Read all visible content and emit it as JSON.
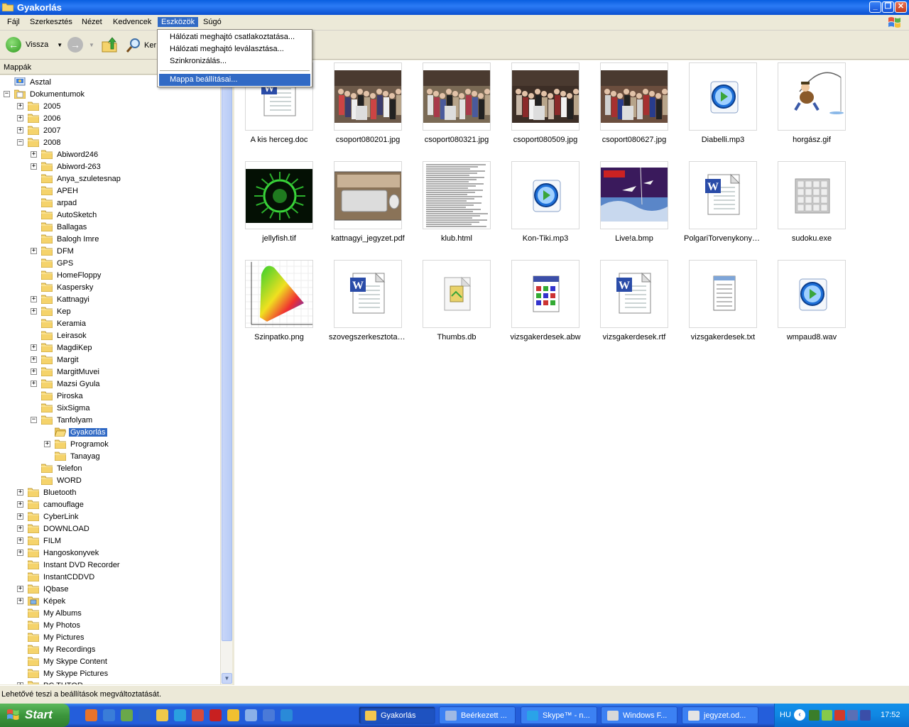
{
  "window": {
    "title": "Gyakorlás"
  },
  "menubar": {
    "items": [
      "Fájl",
      "Szerkesztés",
      "Nézet",
      "Kedvencek",
      "Eszközök",
      "Súgó"
    ],
    "active": "Eszközök"
  },
  "toolbar": {
    "back_label": "Vissza",
    "search_label": "Ker"
  },
  "dropdown": {
    "items": [
      "Hálózati meghajtó csatlakoztatása...",
      "Hálózati meghajtó leválasztása...",
      "Szinkronizálás...",
      "Mappa beállításai..."
    ],
    "highlighted": "Mappa beállításai..."
  },
  "folders_pane": {
    "title": "Mappák"
  },
  "tree": [
    {
      "label": "Asztal",
      "level": 0,
      "exp": "none",
      "icon": "desktop"
    },
    {
      "label": "Dokumentumok",
      "level": 0,
      "exp": "minus",
      "icon": "docs"
    },
    {
      "label": "2005",
      "level": 1,
      "exp": "plus"
    },
    {
      "label": "2006",
      "level": 1,
      "exp": "plus"
    },
    {
      "label": "2007",
      "level": 1,
      "exp": "plus"
    },
    {
      "label": "2008",
      "level": 1,
      "exp": "minus"
    },
    {
      "label": "Abiword246",
      "level": 2,
      "exp": "plus"
    },
    {
      "label": "Abiword-263",
      "level": 2,
      "exp": "plus"
    },
    {
      "label": "Anya_szuletesnap",
      "level": 2,
      "exp": "none"
    },
    {
      "label": "APEH",
      "level": 2,
      "exp": "none"
    },
    {
      "label": "arpad",
      "level": 2,
      "exp": "none"
    },
    {
      "label": "AutoSketch",
      "level": 2,
      "exp": "none"
    },
    {
      "label": "Ballagas",
      "level": 2,
      "exp": "none"
    },
    {
      "label": "Balogh Imre",
      "level": 2,
      "exp": "none"
    },
    {
      "label": "DFM",
      "level": 2,
      "exp": "plus"
    },
    {
      "label": "GPS",
      "level": 2,
      "exp": "none"
    },
    {
      "label": "HomeFloppy",
      "level": 2,
      "exp": "none"
    },
    {
      "label": "Kaspersky",
      "level": 2,
      "exp": "none"
    },
    {
      "label": "Kattnagyi",
      "level": 2,
      "exp": "plus"
    },
    {
      "label": "Kep",
      "level": 2,
      "exp": "plus"
    },
    {
      "label": "Keramia",
      "level": 2,
      "exp": "none"
    },
    {
      "label": "Leirasok",
      "level": 2,
      "exp": "none"
    },
    {
      "label": "MagdiKep",
      "level": 2,
      "exp": "plus"
    },
    {
      "label": "Margit",
      "level": 2,
      "exp": "plus"
    },
    {
      "label": "MargitMuvei",
      "level": 2,
      "exp": "plus"
    },
    {
      "label": "Mazsi Gyula",
      "level": 2,
      "exp": "plus"
    },
    {
      "label": "Piroska",
      "level": 2,
      "exp": "none"
    },
    {
      "label": "SixSigma",
      "level": 2,
      "exp": "none"
    },
    {
      "label": "Tanfolyam",
      "level": 2,
      "exp": "minus"
    },
    {
      "label": "Gyakorlás",
      "level": 3,
      "exp": "none",
      "selected": true,
      "open": true
    },
    {
      "label": "Programok",
      "level": 3,
      "exp": "plus"
    },
    {
      "label": "Tanayag",
      "level": 3,
      "exp": "none"
    },
    {
      "label": "Telefon",
      "level": 2,
      "exp": "none"
    },
    {
      "label": "WORD",
      "level": 2,
      "exp": "none"
    },
    {
      "label": "Bluetooth",
      "level": 1,
      "exp": "plus"
    },
    {
      "label": "camouflage",
      "level": 1,
      "exp": "plus"
    },
    {
      "label": "CyberLink",
      "level": 1,
      "exp": "plus"
    },
    {
      "label": "DOWNLOAD",
      "level": 1,
      "exp": "plus"
    },
    {
      "label": "FILM",
      "level": 1,
      "exp": "plus"
    },
    {
      "label": "Hangoskonyvek",
      "level": 1,
      "exp": "plus"
    },
    {
      "label": "Instant DVD Recorder",
      "level": 1,
      "exp": "none"
    },
    {
      "label": "InstantCDDVD",
      "level": 1,
      "exp": "none"
    },
    {
      "label": "IQbase",
      "level": 1,
      "exp": "plus"
    },
    {
      "label": "Képek",
      "level": 1,
      "exp": "plus",
      "icon": "pictures"
    },
    {
      "label": "My Albums",
      "level": 1,
      "exp": "none"
    },
    {
      "label": "My Photos",
      "level": 1,
      "exp": "none"
    },
    {
      "label": "My Pictures",
      "level": 1,
      "exp": "none"
    },
    {
      "label": "My Recordings",
      "level": 1,
      "exp": "none"
    },
    {
      "label": "My Skype Content",
      "level": 1,
      "exp": "none"
    },
    {
      "label": "My Skype Pictures",
      "level": 1,
      "exp": "none"
    },
    {
      "label": "PC TUTOR",
      "level": 1,
      "exp": "plus"
    }
  ],
  "files": [
    {
      "name": "A kis herceg.doc",
      "thumb": "word"
    },
    {
      "name": "csoport080201.jpg",
      "thumb": "photo"
    },
    {
      "name": "csoport080321.jpg",
      "thumb": "photo"
    },
    {
      "name": "csoport080509.jpg",
      "thumb": "photo"
    },
    {
      "name": "csoport080627.jpg",
      "thumb": "photo"
    },
    {
      "name": "Diabelli.mp3",
      "thumb": "media"
    },
    {
      "name": "horgász.gif",
      "thumb": "fisher"
    },
    {
      "name": "jellyfish.tif",
      "thumb": "jelly"
    },
    {
      "name": "kattnagyi_jegyzet.pdf",
      "thumb": "keyboard"
    },
    {
      "name": "klub.html",
      "thumb": "textpage"
    },
    {
      "name": "Kon-Tiki.mp3",
      "thumb": "media"
    },
    {
      "name": "Live!a.bmp",
      "thumb": "live"
    },
    {
      "name": "PolgariTorvenykonyv.rtf",
      "thumb": "word"
    },
    {
      "name": "sudoku.exe",
      "thumb": "sudoku"
    },
    {
      "name": "Szinpatko.png",
      "thumb": "cie"
    },
    {
      "name": "szovegszerkesztotanf...",
      "thumb": "word"
    },
    {
      "name": "Thumbs.db",
      "thumb": "db"
    },
    {
      "name": "vizsgakerdesek.abw",
      "thumb": "abw"
    },
    {
      "name": "vizsgakerdesek.rtf",
      "thumb": "word"
    },
    {
      "name": "vizsgakerdesek.txt",
      "thumb": "notepad"
    },
    {
      "name": "wmpaud8.wav",
      "thumb": "media"
    }
  ],
  "statusbar": {
    "text": "Lehetővé teszi a beállítások megváltoztatását."
  },
  "taskbar": {
    "start_label": "Start",
    "quicklaunch_icons": [
      "firefox-icon",
      "internet-icon",
      "messenger-icon",
      "media-icon",
      "folder-icon",
      "search-icon",
      "paint-icon",
      "opera-icon",
      "smiley-icon",
      "chat-icon",
      "update-icon",
      "ie-icon"
    ],
    "tasks": [
      {
        "label": "Gyakorlás",
        "active": true,
        "color": "#f3c74f"
      },
      {
        "label": "Beérkezett ...",
        "active": false,
        "color": "#9fb9e4"
      },
      {
        "label": "Skype™ - n...",
        "active": false,
        "color": "#2aa3e8"
      },
      {
        "label": "Windows F...",
        "active": false,
        "color": "#d8d8d8"
      },
      {
        "label": "jegyzet.od...",
        "active": false,
        "color": "#e4e4e4"
      }
    ],
    "tray": {
      "lang": "HU",
      "clock": "17:52"
    }
  }
}
